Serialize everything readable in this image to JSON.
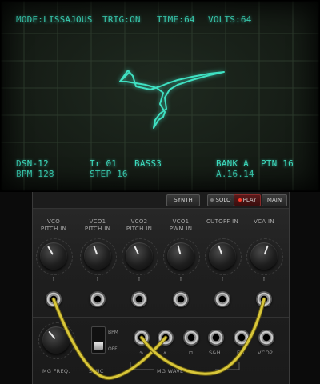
{
  "screen": {
    "mode": "MODE:LISSAJOUS",
    "trig": "TRIG:ON",
    "time": "TIME:64",
    "volts": "VOLTS:64",
    "patch_name": "DSN-12",
    "track": "Tr 01",
    "instrument": "BASS3",
    "bank": "BANK A",
    "pattern": "PTN 16",
    "bpm": "BPM 128",
    "step": "STEP 16",
    "position": "A.16.14",
    "trace_color": "#3fe0c2"
  },
  "toolbar": {
    "synth": "SYNTH",
    "solo": "SOLO",
    "play": "PLAY",
    "main": "MAIN"
  },
  "knobs": [
    {
      "label1": "VCO",
      "label2": "PITCH IN"
    },
    {
      "label1": "VCO1",
      "label2": "PITCH IN"
    },
    {
      "label1": "VCO2",
      "label2": "PITCH IN"
    },
    {
      "label1": "VCO1",
      "label2": "PWM IN"
    },
    {
      "label1": "CUTOFF IN",
      "label2": ""
    },
    {
      "label1": "VCA IN",
      "label2": ""
    }
  ],
  "mg": {
    "freq_label": "MG FREQ.",
    "bpm_label": "BPM",
    "off_label": "OFF",
    "sync_label": "SYNC",
    "wave_label": "MG WAVE",
    "outputs": [
      "∿",
      "ʌ",
      "⊓",
      "S&H",
      "EG",
      "VCO2"
    ]
  },
  "accent": "#c8b830"
}
